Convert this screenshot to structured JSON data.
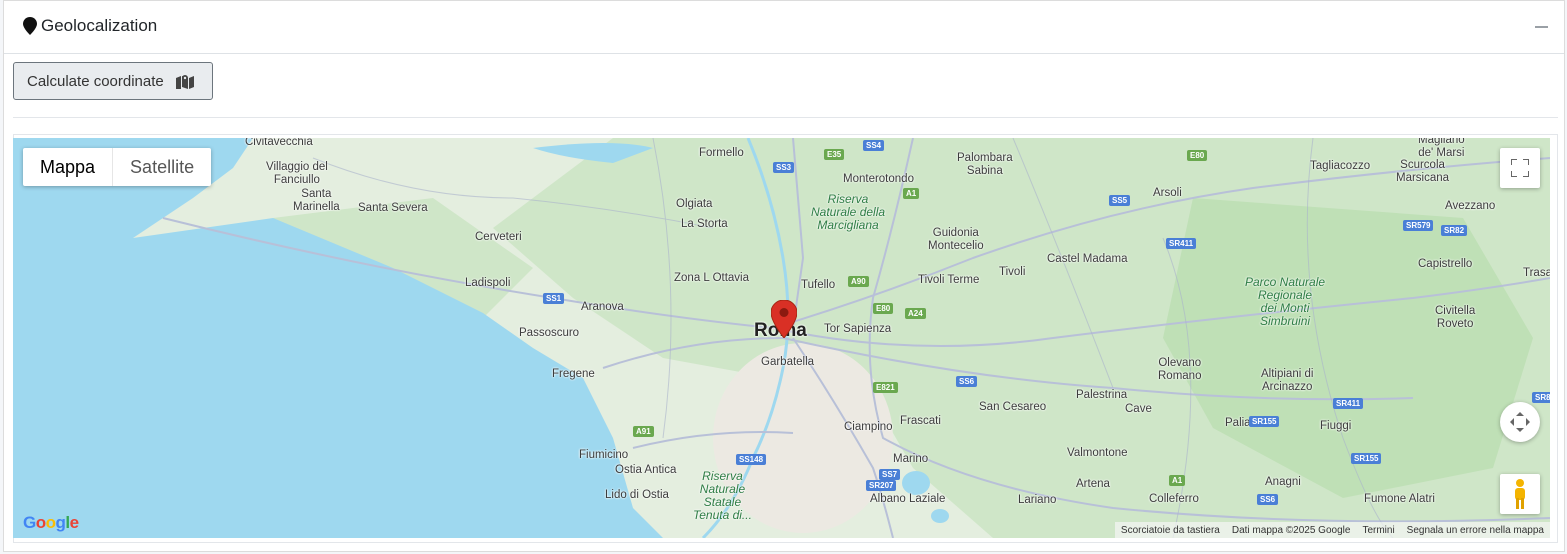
{
  "card": {
    "title": "Geolocalization",
    "title_icon": "map-marker-icon",
    "collapse_icon": "minus-icon"
  },
  "toolbar": {
    "calculate_label": "Calculate coordinate",
    "calculate_icon": "map-marked-icon"
  },
  "map": {
    "map_types": [
      {
        "label": "Mappa",
        "active": true
      },
      {
        "label": "Satellite",
        "active": false
      }
    ],
    "marker_color": "#d93025",
    "water_color": "#9ed8ef",
    "land_color": "#e4eedf",
    "footer": {
      "shortcuts": "Scorciatoie da tastiera",
      "data": "Dati mappa ©2025 Google",
      "terms": "Termini",
      "report": "Segnala un errore nella mappa"
    },
    "logo": "Google",
    "places": [
      {
        "name": "Civitavecchia"
      },
      {
        "name": "Villaggio del Fanciullo"
      },
      {
        "name": "Santa Marinella"
      },
      {
        "name": "Santa Severa"
      },
      {
        "name": "Cerveteri"
      },
      {
        "name": "Ladispoli"
      },
      {
        "name": "Aranova"
      },
      {
        "name": "Passoscuro"
      },
      {
        "name": "Fregene"
      },
      {
        "name": "Fiumicino"
      },
      {
        "name": "Ostia Antica"
      },
      {
        "name": "Lido di Ostia"
      },
      {
        "name": "Formello"
      },
      {
        "name": "Olgiata"
      },
      {
        "name": "La Storta"
      },
      {
        "name": "Zona L Ottavia"
      },
      {
        "name": "Tufello"
      },
      {
        "name": "Roma"
      },
      {
        "name": "Garbatella"
      },
      {
        "name": "Tor Sapienza"
      },
      {
        "name": "Monterotondo"
      },
      {
        "name": "Palombara Sabina"
      },
      {
        "name": "Guidonia Montecelio"
      },
      {
        "name": "Tivoli Terme"
      },
      {
        "name": "Tivoli"
      },
      {
        "name": "Castel Madama"
      },
      {
        "name": "Arsoli"
      },
      {
        "name": "Tagliacozzo"
      },
      {
        "name": "Scurcola Marsicana"
      },
      {
        "name": "Magliano de' Marsi"
      },
      {
        "name": "Avezzano"
      },
      {
        "name": "Capistrello"
      },
      {
        "name": "Civitella Roveto"
      },
      {
        "name": "Trasa"
      },
      {
        "name": "Ciampino"
      },
      {
        "name": "Frascati"
      },
      {
        "name": "Marino"
      },
      {
        "name": "Albano Laziale"
      },
      {
        "name": "Lariano"
      },
      {
        "name": "Artena"
      },
      {
        "name": "Colleferro"
      },
      {
        "name": "Valmontone"
      },
      {
        "name": "San Cesareo"
      },
      {
        "name": "Palestrina"
      },
      {
        "name": "Cave"
      },
      {
        "name": "Olevano Romano"
      },
      {
        "name": "Paliano"
      },
      {
        "name": "Fiuggi"
      },
      {
        "name": "Anagni"
      },
      {
        "name": "Fumone Alatri"
      },
      {
        "name": "Altipiani di Arcinazzo"
      }
    ],
    "parks": [
      {
        "name": "Riserva Naturale della Marcigliana"
      },
      {
        "name": "Parco Naturale Regionale dei Monti Simbruini"
      },
      {
        "name": "Riserva Naturale Statale Tenuta di..."
      }
    ],
    "roads": [
      "SS3",
      "SS4",
      "E35",
      "E80",
      "A1",
      "SS5",
      "SR411",
      "SR579",
      "SR82",
      "SS1",
      "A90",
      "E80",
      "A24",
      "E821",
      "SS6",
      "A91",
      "SS148",
      "SS7",
      "SR207",
      "SR155",
      "SS6",
      "A1",
      "SR411",
      "SR155",
      "SR8"
    ]
  }
}
